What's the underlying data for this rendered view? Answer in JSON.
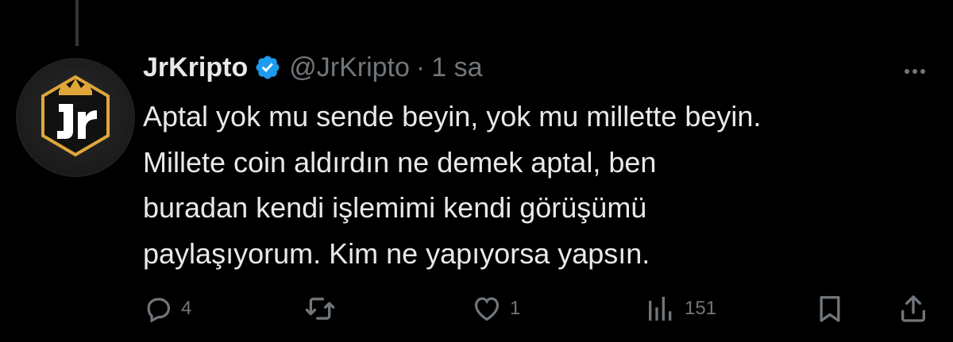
{
  "tweet": {
    "display_name": "JrKripto",
    "verified": true,
    "handle": "@JrKripto",
    "separator": "·",
    "time": "1 sa",
    "text": "Aptal yok mu sende beyin, yok mu millette beyin.\nMillete coin aldırdın ne demek aptal, ben\nburadan kendi işlemimi kendi görüşümü\npaylaşıyorum. Kim ne yapıyorsa yapsın.",
    "avatar_label": "JR"
  },
  "actions": {
    "reply_count": "4",
    "retweet_count": "",
    "like_count": "1",
    "views_count": "151"
  },
  "colors": {
    "background": "#000000",
    "text_primary": "#e7e9ea",
    "text_secondary": "#71767b",
    "verified_blue": "#1d9bf0",
    "avatar_gold": "#e0a63a"
  },
  "icons": [
    "more-icon",
    "verified-badge-icon",
    "reply-icon",
    "retweet-icon",
    "like-icon",
    "views-icon",
    "bookmark-icon",
    "share-icon"
  ]
}
